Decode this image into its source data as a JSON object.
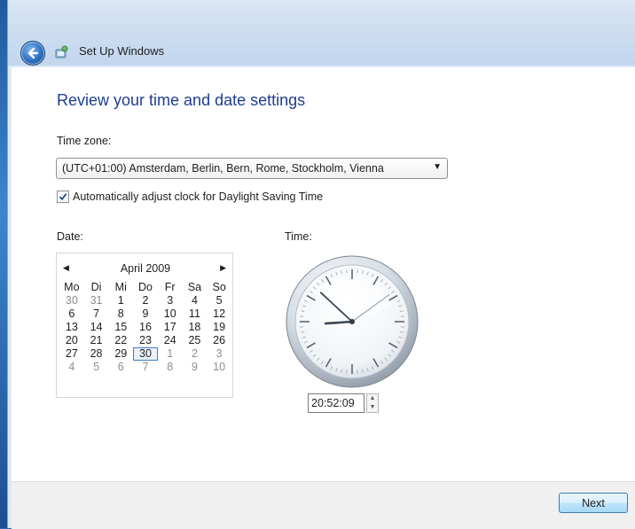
{
  "header": {
    "title": "Set Up Windows",
    "back_icon": "back-arrow-icon",
    "app_icon": "setup-windows-icon"
  },
  "main": {
    "heading": "Review your time and date settings",
    "time_zone_label": "Time zone:",
    "time_zone_value": "(UTC+01:00) Amsterdam, Berlin, Bern, Rome, Stockholm, Vienna",
    "dst_label": "Automatically adjust clock for Daylight Saving Time",
    "dst_checked": true,
    "date_label": "Date:",
    "time_label": "Time:"
  },
  "calendar": {
    "month_title": "April 2009",
    "weekdays": [
      "Mo",
      "Di",
      "Mi",
      "Do",
      "Fr",
      "Sa",
      "So"
    ],
    "days": [
      {
        "d": "30",
        "other": true
      },
      {
        "d": "31",
        "other": true
      },
      {
        "d": "1"
      },
      {
        "d": "2"
      },
      {
        "d": "3"
      },
      {
        "d": "4"
      },
      {
        "d": "5"
      },
      {
        "d": "6"
      },
      {
        "d": "7"
      },
      {
        "d": "8"
      },
      {
        "d": "9"
      },
      {
        "d": "10"
      },
      {
        "d": "11"
      },
      {
        "d": "12"
      },
      {
        "d": "13"
      },
      {
        "d": "14"
      },
      {
        "d": "15"
      },
      {
        "d": "16"
      },
      {
        "d": "17"
      },
      {
        "d": "18"
      },
      {
        "d": "19"
      },
      {
        "d": "20"
      },
      {
        "d": "21"
      },
      {
        "d": "22"
      },
      {
        "d": "23"
      },
      {
        "d": "24"
      },
      {
        "d": "25"
      },
      {
        "d": "26"
      },
      {
        "d": "27"
      },
      {
        "d": "28"
      },
      {
        "d": "29"
      },
      {
        "d": "30",
        "selected": true
      },
      {
        "d": "1",
        "other": true
      },
      {
        "d": "2",
        "other": true
      },
      {
        "d": "3",
        "other": true
      },
      {
        "d": "4",
        "other": true
      },
      {
        "d": "5",
        "other": true
      },
      {
        "d": "6",
        "other": true
      },
      {
        "d": "7",
        "other": true
      },
      {
        "d": "8",
        "other": true
      },
      {
        "d": "9",
        "other": true
      },
      {
        "d": "10",
        "other": true
      }
    ]
  },
  "clock": {
    "time": "20:52:09",
    "hours": 20,
    "minutes": 52,
    "seconds": 9
  },
  "footer": {
    "next_label": "Next"
  },
  "colors": {
    "heading": "#1e3d8f",
    "selected_day_border": "#3d7bc6"
  }
}
